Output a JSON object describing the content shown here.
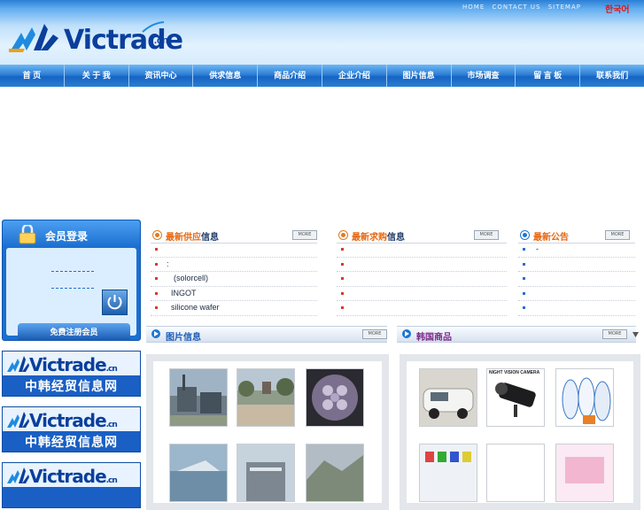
{
  "header": {
    "top_links": [
      "HOME",
      "CONTACT US",
      "SITEMAP"
    ],
    "lang_link": "한국어",
    "logo_text": "Victrade",
    "logo_suffix": ".cn"
  },
  "nav": {
    "items": [
      "首 页",
      "关 于 我",
      "资讯中心",
      "供求信息",
      "商品介绍",
      "企业介绍",
      "图片信息",
      "市场调查",
      "留 言 板",
      "联系我们"
    ]
  },
  "login": {
    "title": "会员登录",
    "register_label": "免费注册会员"
  },
  "banners": [
    {
      "logo": "Victrade",
      "suffix": ".cn",
      "subtitle": "中韩经贸信息网"
    },
    {
      "logo": "Victrade",
      "suffix": ".cn",
      "subtitle": "中韩经贸信息网"
    },
    {
      "logo": "Victrade",
      "suffix": ".cn",
      "subtitle": ""
    }
  ],
  "supply": {
    "title_a": "最新",
    "title_b": "供应",
    "title_c": "信息",
    "more": "MORE",
    "rows": [
      "",
      ":",
      "(solorcell)",
      "INGOT",
      "silicone wafer"
    ]
  },
  "demand": {
    "title_a": "最新",
    "title_b": "求购",
    "title_c": "信息",
    "more": "MORE",
    "rows": [
      "",
      "",
      "",
      "",
      ""
    ]
  },
  "notice": {
    "title_a": "最新",
    "title_b": "公告",
    "more": "MORE",
    "rows": [
      "-",
      "",
      "",
      "",
      ""
    ]
  },
  "photo_bar": {
    "title": "图片信息",
    "more": "MORE"
  },
  "korea_bar": {
    "title": "韩国商品",
    "more": "MORE"
  },
  "products": {
    "camera_caption": "NIGHT VISION CAMERA"
  },
  "colors": {
    "brand_blue": "#0a3f9c",
    "nav_blue": "#1664c2",
    "accent_orange": "#e56812"
  }
}
